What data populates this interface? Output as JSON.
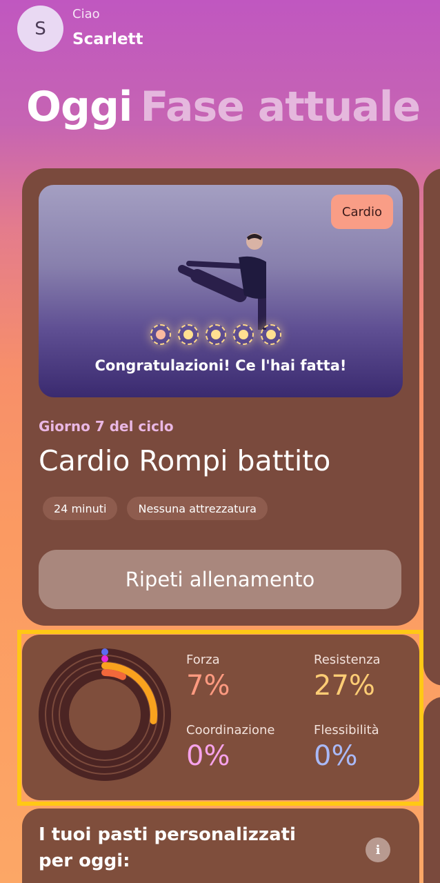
{
  "header": {
    "avatar_initial": "S",
    "greeting": "Ciao",
    "username": "Scarlett"
  },
  "tabs": [
    {
      "label": "Oggi",
      "active": true
    },
    {
      "label": "Fase attuale",
      "active": false
    }
  ],
  "workout_card": {
    "category_badge": "Cardio",
    "progress_dots": {
      "total": 5,
      "completed": 5
    },
    "congrats_message": "Congratulazioni! Ce l'hai fatta!",
    "cycle_day": "Giorno 7 del ciclo",
    "title": "Cardio Rompi battito",
    "chips": [
      "24 minuti",
      "Nessuna attrezzatura"
    ],
    "repeat_button": "Ripeti allenamento"
  },
  "stats_card": {
    "stats": [
      {
        "label": "Forza",
        "value": "7%",
        "percent": 7,
        "color": "#ff8a6b"
      },
      {
        "label": "Resistenza",
        "value": "27%",
        "percent": 27,
        "color": "#ffb347"
      },
      {
        "label": "Coordinazione",
        "value": "0%",
        "percent": 0,
        "color": "#f08ee0"
      },
      {
        "label": "Flessibilità",
        "value": "0%",
        "percent": 0,
        "color": "#9fb0f5"
      }
    ],
    "ring_colors": {
      "track": "#4b2423",
      "ring_line": "#7b4a3c",
      "resistenza": "#f9a21e",
      "forza": "#f2683b",
      "coordinazione": "#e728d8",
      "flessibilita": "#5a6cf0"
    }
  },
  "meals_card": {
    "title": "I tuoi pasti personalizzati per oggi:",
    "info_icon": "info-icon"
  },
  "colors": {
    "card_bg": "#7a4a3d",
    "highlight": "#ffc816",
    "cycle_day": "#e9b7e3"
  }
}
